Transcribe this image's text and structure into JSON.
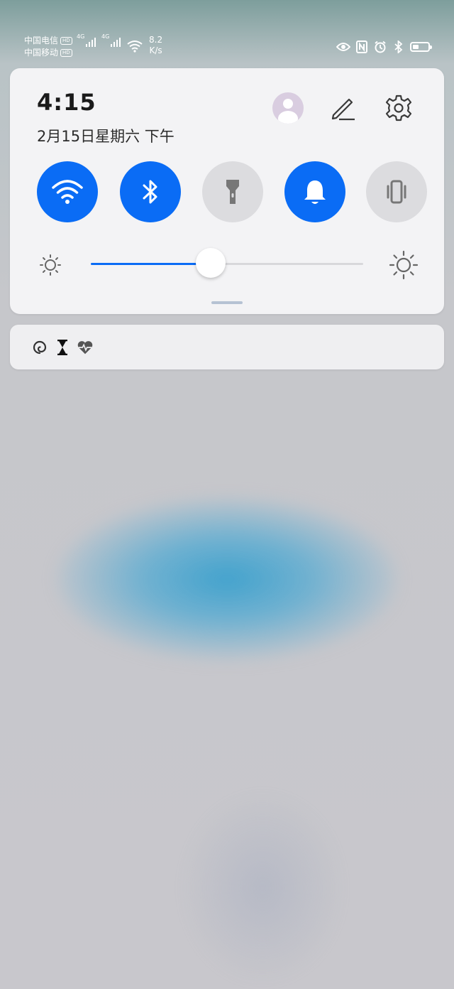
{
  "status_bar": {
    "carrier_1": "中国电信",
    "carrier_2": "中国移动",
    "hd_badge": "HD",
    "network_1": "4G",
    "network_2": "4G",
    "speed_value": "8.2",
    "speed_unit": "K/s",
    "battery_level": 0.3,
    "icons": [
      "eye-icon",
      "nfc-icon",
      "alarm-icon",
      "bluetooth-icon",
      "battery-icon"
    ]
  },
  "panel": {
    "time": "4:15",
    "date": "2月15日星期六 下午",
    "header_icons": [
      "avatar-icon",
      "edit-icon",
      "settings-icon"
    ],
    "tiles": [
      {
        "name": "wifi",
        "icon": "wifi-icon",
        "active": true
      },
      {
        "name": "bluetooth",
        "icon": "bluetooth-icon",
        "active": true
      },
      {
        "name": "flashlight",
        "icon": "flashlight-icon",
        "active": false
      },
      {
        "name": "sound",
        "icon": "bell-icon",
        "active": true
      },
      {
        "name": "vibrate",
        "icon": "vibrate-icon",
        "active": false
      }
    ],
    "brightness": {
      "level_percent": 44,
      "low_icon": "brightness-low-icon",
      "high_icon": "brightness-high-icon"
    }
  },
  "notification_icons": [
    "spiral-app-icon",
    "hourglass-icon",
    "heart-pulse-icon"
  ],
  "colors": {
    "accent": "#0a6cf5",
    "tile_off": "#dcdcdf",
    "panel_bg": "#f3f3f5"
  }
}
